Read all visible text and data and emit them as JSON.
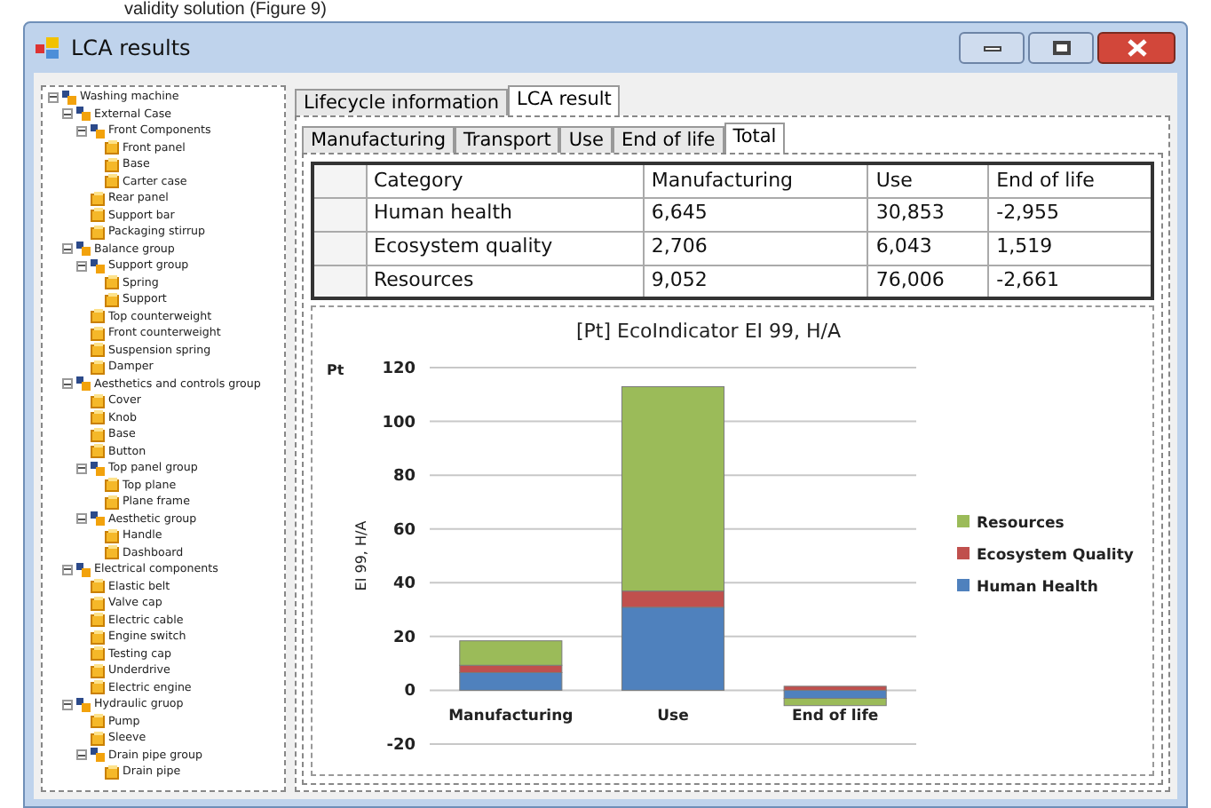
{
  "document_text": "validity solution (Figure 9)",
  "window": {
    "title": "LCA results"
  },
  "tree": [
    {
      "label": "Washing machine",
      "kind": "group",
      "expanded": true,
      "children": [
        {
          "label": "External Case",
          "kind": "group",
          "expanded": true,
          "children": [
            {
              "label": "Front Components",
              "kind": "group",
              "expanded": true,
              "children": [
                {
                  "label": "Front panel",
                  "kind": "part"
                },
                {
                  "label": "Base",
                  "kind": "part"
                },
                {
                  "label": "Carter case",
                  "kind": "part"
                }
              ]
            },
            {
              "label": "Rear panel",
              "kind": "part"
            },
            {
              "label": "Support bar",
              "kind": "part"
            },
            {
              "label": "Packaging stirrup",
              "kind": "part"
            }
          ]
        },
        {
          "label": "Balance group",
          "kind": "group",
          "expanded": true,
          "children": [
            {
              "label": "Support group",
              "kind": "group",
              "expanded": true,
              "children": [
                {
                  "label": "Spring",
                  "kind": "part"
                },
                {
                  "label": "Support",
                  "kind": "part"
                }
              ]
            },
            {
              "label": "Top counterweight",
              "kind": "part"
            },
            {
              "label": "Front counterweight",
              "kind": "part"
            },
            {
              "label": "Suspension spring",
              "kind": "part"
            },
            {
              "label": "Damper",
              "kind": "part"
            }
          ]
        },
        {
          "label": "Aesthetics and controls group",
          "kind": "group",
          "expanded": true,
          "children": [
            {
              "label": "Cover",
              "kind": "part"
            },
            {
              "label": "Knob",
              "kind": "part"
            },
            {
              "label": "Base",
              "kind": "part"
            },
            {
              "label": "Button",
              "kind": "part"
            },
            {
              "label": "Top panel group",
              "kind": "group",
              "expanded": true,
              "children": [
                {
                  "label": "Top plane",
                  "kind": "part"
                },
                {
                  "label": "Plane frame",
                  "kind": "part"
                }
              ]
            },
            {
              "label": "Aesthetic group",
              "kind": "group",
              "expanded": true,
              "children": [
                {
                  "label": "Handle",
                  "kind": "part"
                },
                {
                  "label": "Dashboard",
                  "kind": "part"
                }
              ]
            }
          ]
        },
        {
          "label": "Electrical components",
          "kind": "group",
          "expanded": true,
          "children": [
            {
              "label": "Elastic belt",
              "kind": "part"
            },
            {
              "label": "Valve cap",
              "kind": "part"
            },
            {
              "label": "Electric cable",
              "kind": "part"
            },
            {
              "label": "Engine switch",
              "kind": "part"
            },
            {
              "label": "Testing cap",
              "kind": "part"
            },
            {
              "label": "Underdrive",
              "kind": "part"
            },
            {
              "label": "Electric engine",
              "kind": "part"
            }
          ]
        },
        {
          "label": "Hydraulic gruop",
          "kind": "group",
          "expanded": true,
          "children": [
            {
              "label": "Pump",
              "kind": "part"
            },
            {
              "label": "Sleeve",
              "kind": "part"
            },
            {
              "label": "Drain pipe group",
              "kind": "group",
              "expanded": true,
              "children": [
                {
                  "label": "Drain pipe",
                  "kind": "part"
                }
              ]
            }
          ]
        }
      ]
    }
  ],
  "tabs": [
    {
      "label": "Lifecycle information",
      "selected": false
    },
    {
      "label": "LCA result",
      "selected": true
    }
  ],
  "subtabs": [
    {
      "label": "Manufacturing",
      "selected": false
    },
    {
      "label": "Transport",
      "selected": false
    },
    {
      "label": "Use",
      "selected": false
    },
    {
      "label": "End of life",
      "selected": false
    },
    {
      "label": "Total",
      "selected": true
    }
  ],
  "table": {
    "columns": [
      "Category",
      "Manufacturing",
      "Use",
      "End of life"
    ],
    "rows": [
      [
        "Human health",
        "6,645",
        "30,853",
        "-2,955"
      ],
      [
        "Ecosystem quality",
        "2,706",
        "6,043",
        "1,519"
      ],
      [
        "Resources",
        "9,052",
        "76,006",
        "-2,661"
      ]
    ]
  },
  "chart": {
    "unit_label": "Pt",
    "chart_data": {
      "type": "bar",
      "title": "[Pt] EcoIndicator EI 99, H/A",
      "ylabel": "EI 99, H/A",
      "categories": [
        "Manufacturing",
        "Use",
        "End of life"
      ],
      "stacked": true,
      "series": [
        {
          "name": "Human Health",
          "color": "#4f81bd",
          "values": [
            6.6,
            30.9,
            -3.0
          ]
        },
        {
          "name": "Ecosystem Quality",
          "color": "#c0504d",
          "values": [
            2.7,
            6.0,
            1.5
          ]
        },
        {
          "name": "Resources",
          "color": "#9bbb59",
          "values": [
            9.1,
            76.0,
            -2.7
          ]
        }
      ],
      "grid": true,
      "legend": true,
      "ylim": [
        -20,
        120
      ],
      "yticks": [
        -20,
        0,
        20,
        40,
        60,
        80,
        100,
        120
      ]
    }
  }
}
